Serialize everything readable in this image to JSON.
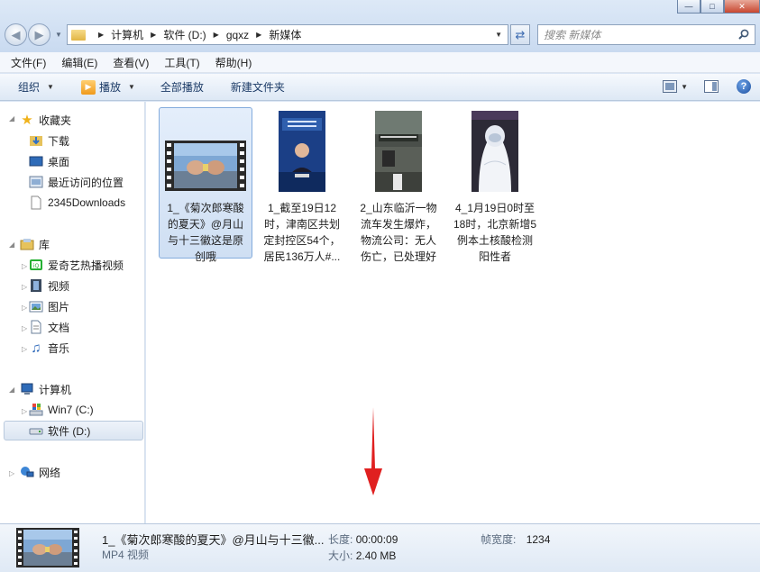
{
  "window": {
    "min_glyph": "—",
    "max_glyph": "□",
    "close_glyph": "✕"
  },
  "address": {
    "breadcrumbs": [
      "计算机",
      "软件 (D:)",
      "gqxz",
      "新媒体"
    ]
  },
  "search": {
    "placeholder": "搜索 新媒体"
  },
  "menu": [
    "文件(F)",
    "编辑(E)",
    "查看(V)",
    "工具(T)",
    "帮助(H)"
  ],
  "toolbar": {
    "organize": "组织",
    "play": "播放",
    "play_all": "全部播放",
    "new_folder": "新建文件夹"
  },
  "sidebar": {
    "favorites": {
      "label": "收藏夹",
      "items": [
        "下载",
        "桌面",
        "最近访问的位置",
        "2345Downloads"
      ]
    },
    "libraries": {
      "label": "库",
      "items": [
        "爱奇艺热播视频",
        "视频",
        "图片",
        "文档",
        "音乐"
      ]
    },
    "computer": {
      "label": "计算机",
      "items": [
        "Win7 (C:)",
        "软件 (D:)"
      ]
    },
    "network": {
      "label": "网络"
    }
  },
  "files": [
    {
      "name_lines": [
        "1_《菊次郎寒酸",
        "的夏天》@月山",
        "与十三徽这是原",
        "创哦"
      ],
      "selected": true
    },
    {
      "name_lines": [
        "1_截至19日12",
        "时，津南区共划",
        "定封控区54个，",
        "居民136万人#..."
      ],
      "selected": false
    },
    {
      "name_lines": [
        "2_山东临沂一物",
        "流车发生爆炸，",
        "物流公司：无人",
        "伤亡，已处理好"
      ],
      "selected": false
    },
    {
      "name_lines": [
        "4_1月19日0时至",
        "18时，北京新增5",
        "例本土核酸检测",
        "阳性者"
      ],
      "selected": false
    }
  ],
  "details": {
    "name": "1_《菊次郎寒酸的夏天》@月山与十三徽...",
    "type": "MP4 视频",
    "length_label": "长度:",
    "length_value": "00:00:09",
    "size_label": "大小:",
    "size_value": "2.40 MB",
    "framewidth_label": "帧宽度:",
    "framewidth_value": "1234"
  },
  "colors": {
    "accent": "#1b3a66",
    "selection": "#cfdff3",
    "annotation_arrow": "#e02020"
  }
}
